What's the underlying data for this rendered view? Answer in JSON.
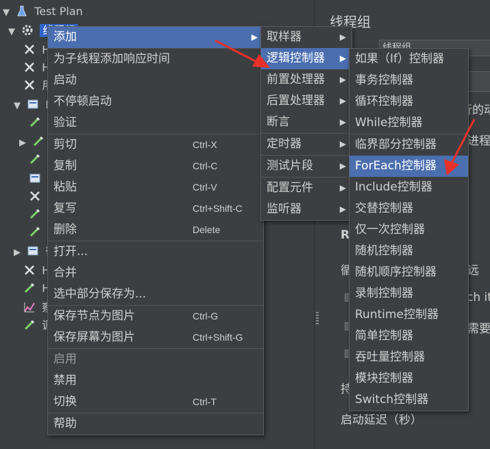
{
  "tree": {
    "items": [
      {
        "label": "Test Plan",
        "arrow": "▼",
        "icon": "flask-icon"
      },
      {
        "label": "线程组",
        "arrow": "▼",
        "icon": "gear-icon",
        "selected": true
      },
      {
        "label": "H",
        "icon": "wrench-icon"
      },
      {
        "label": "H",
        "icon": "wrench-icon"
      },
      {
        "label": "用",
        "icon": "wrench-icon"
      },
      {
        "label": "F",
        "arrow": "▼",
        "icon": "controller-icon"
      },
      {
        "label": "",
        "icon": "pipette-icon"
      },
      {
        "label": "",
        "arrow": "▶",
        "icon": "pipette-icon"
      },
      {
        "label": "",
        "icon": "pipette-icon"
      },
      {
        "label": "",
        "icon": "controller-icon"
      },
      {
        "label": "",
        "icon": "wrench-icon"
      },
      {
        "label": "",
        "icon": "pipette-icon"
      },
      {
        "label": "",
        "icon": "pipette-icon"
      },
      {
        "label": "循",
        "arrow": "▶",
        "icon": "controller-icon"
      },
      {
        "label": "H",
        "icon": "wrench-icon"
      },
      {
        "label": "H",
        "icon": "pipette-icon"
      },
      {
        "label": "察",
        "icon": "graph-icon"
      },
      {
        "label": "调",
        "icon": "pipette-icon"
      }
    ]
  },
  "right_panel": {
    "title": "线程组",
    "field1_value": "线程组",
    "partial_text_1": "行的动",
    "partial_text_2": "进程",
    "partial_text_3": "R",
    "partial_text_4": "循",
    "partial_text_5": "远",
    "partial_text_6": "ch it",
    "partial_text_7": "需要",
    "partial_text_8": "持",
    "partial_text_9": "启动延迟（秒）"
  },
  "context_menu": {
    "items": [
      {
        "label": "添加",
        "submenu": true,
        "highlight": true
      },
      {
        "sep": true
      },
      {
        "label": "为子线程添加响应时间"
      },
      {
        "label": "启动"
      },
      {
        "label": "不停顿启动"
      },
      {
        "label": "验证"
      },
      {
        "sep": true
      },
      {
        "label": "剪切",
        "shortcut": "Ctrl-X"
      },
      {
        "label": "复制",
        "shortcut": "Ctrl-C"
      },
      {
        "label": "粘贴",
        "shortcut": "Ctrl-V"
      },
      {
        "label": "复写",
        "shortcut": "Ctrl+Shift-C"
      },
      {
        "label": "删除",
        "shortcut": "Delete"
      },
      {
        "sep": true
      },
      {
        "label": "打开..."
      },
      {
        "label": "合并"
      },
      {
        "label": "选中部分保存为..."
      },
      {
        "sep": true
      },
      {
        "label": "保存节点为图片",
        "shortcut": "Ctrl-G"
      },
      {
        "label": "保存屏幕为图片",
        "shortcut": "Ctrl+Shift-G"
      },
      {
        "sep": true
      },
      {
        "label": "启用",
        "disabled": true
      },
      {
        "label": "禁用"
      },
      {
        "label": "切换",
        "shortcut": "Ctrl-T"
      },
      {
        "sep": true
      },
      {
        "label": "帮助"
      }
    ]
  },
  "add_menu": {
    "items": [
      {
        "label": "取样器",
        "submenu": true
      },
      {
        "label": "逻辑控制器",
        "submenu": true,
        "highlight": true
      },
      {
        "label": "前置处理器",
        "submenu": true
      },
      {
        "label": "后置处理器",
        "submenu": true
      },
      {
        "label": "断言",
        "submenu": true
      },
      {
        "sep": true
      },
      {
        "label": "定时器",
        "submenu": true
      },
      {
        "sep": true
      },
      {
        "label": "测试片段",
        "submenu": true
      },
      {
        "sep": true
      },
      {
        "label": "配置元件",
        "submenu": true
      },
      {
        "label": "监听器",
        "submenu": true
      }
    ]
  },
  "logic_menu": {
    "items": [
      {
        "label": "如果（If）控制器"
      },
      {
        "label": "事务控制器"
      },
      {
        "label": "循环控制器"
      },
      {
        "label": "While控制器"
      },
      {
        "sep": true
      },
      {
        "label": "临界部分控制器"
      },
      {
        "label": "ForEach控制器",
        "highlight": true
      },
      {
        "label": "Include控制器"
      },
      {
        "label": "交替控制器"
      },
      {
        "label": "仅一次控制器"
      },
      {
        "label": "随机控制器"
      },
      {
        "label": "随机顺序控制器"
      },
      {
        "label": "录制控制器"
      },
      {
        "label": "Runtime控制器"
      },
      {
        "label": "简单控制器"
      },
      {
        "label": "吞吐量控制器"
      },
      {
        "label": "模块控制器"
      },
      {
        "label": "Switch控制器"
      }
    ]
  },
  "colors": {
    "highlight": "#4b6eaf",
    "selected": "#2f65ca",
    "annotation": "#e8312a"
  },
  "submenu_arrow": "▶"
}
